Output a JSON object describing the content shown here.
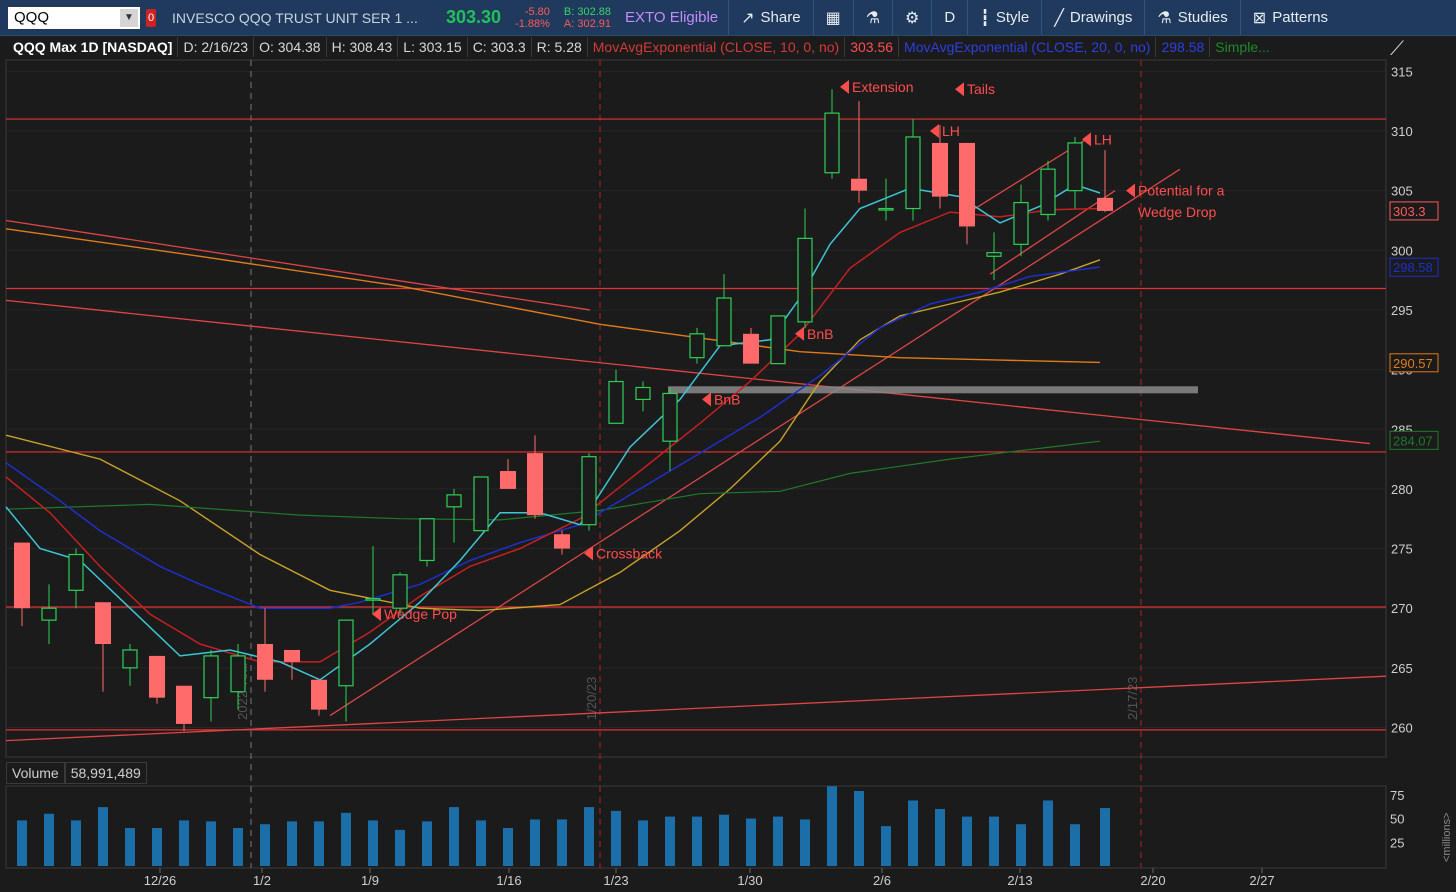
{
  "toolbar": {
    "symbol": "QQQ",
    "alert": "0",
    "description": "INVESCO QQQ TRUST UNIT SER 1 ...",
    "last": "303.30",
    "net_change": "-5.80",
    "pct_change": "-1.88%",
    "bid": "B: 302.88",
    "ask": "A: 302.91",
    "exto": "EXTO Eligible",
    "share": "Share",
    "aggregation": "D",
    "style": "Style",
    "drawings": "Drawings",
    "studies": "Studies",
    "patterns": "Patterns"
  },
  "legend": {
    "title": "QQQ Max 1D [NASDAQ]",
    "date": "D: 2/16/23",
    "open": "O: 304.38",
    "high": "H: 308.43",
    "low": "L: 303.15",
    "close": "C: 303.3",
    "range": "R: 5.28",
    "ema10": "MovAvgExponential (CLOSE, 10, 0, no)",
    "ema10_value": "303.56",
    "ema20": "MovAvgExponential (CLOSE, 20, 0, no)",
    "ema20_value": "298.58",
    "simple": "Simple..."
  },
  "colors": {
    "up": "#2fcf55",
    "down": "#ff6b6b",
    "ema10": "#c71f1f",
    "ema20": "#1d2fcc",
    "ema8": "#3cc6d6",
    "sma_orange": "#e07b1a",
    "sma_gold": "#c9a227",
    "sma_green": "#1e7a2a",
    "annotation": "#ff4d4d",
    "bg": "#1b1b1b",
    "volume": "#1b6ea8"
  },
  "price_axis": {
    "ticks": [
      "315",
      "310",
      "305",
      "300",
      "295",
      "290",
      "285",
      "280",
      "275",
      "270",
      "265",
      "260"
    ],
    "labels": [
      {
        "text": "303.3",
        "color": "#ff5a5a",
        "price": 303.3
      },
      {
        "text": "298.58",
        "color": "#1d2fcc",
        "price": 298.58
      },
      {
        "text": "290.57",
        "color": "#e07b1a",
        "price": 290.57
      },
      {
        "text": "284.07",
        "color": "#1e7a2a",
        "price": 284.07
      }
    ]
  },
  "date_axis": [
    "12/26",
    "1/2",
    "1/9",
    "1/16",
    "1/23",
    "1/30",
    "2/6",
    "2/13",
    "2/20",
    "2/27"
  ],
  "vertical_markers": [
    {
      "text": "2022 Year"
    },
    {
      "text": "1/20/23"
    },
    {
      "text": "2/17/23"
    }
  ],
  "annotations": [
    "Extension",
    "Tails",
    "LH",
    "LH",
    "Potential for a",
    "Wedge Drop",
    "BnB",
    "BnB",
    "Crossback",
    "Wedge Pop"
  ],
  "volume": {
    "label": "Volume",
    "value": "58,991,489",
    "ticks": [
      "75",
      "50",
      "25"
    ],
    "unit": "<millions>"
  },
  "chart_data": {
    "type": "candlestick",
    "title": "QQQ Max 1D [NASDAQ]",
    "ylim": [
      259,
      316
    ],
    "candles": [
      {
        "o": 275.5,
        "h": 275.5,
        "l": 268.5,
        "c": 270.0
      },
      {
        "o": 269.0,
        "h": 272.0,
        "l": 267.0,
        "c": 270.0
      },
      {
        "o": 271.5,
        "h": 275.0,
        "l": 270.0,
        "c": 274.5
      },
      {
        "o": 270.5,
        "h": 270.5,
        "l": 263.0,
        "c": 267.0
      },
      {
        "o": 265.0,
        "h": 267.0,
        "l": 263.5,
        "c": 266.5
      },
      {
        "o": 266.0,
        "h": 266.0,
        "l": 262.0,
        "c": 262.5
      },
      {
        "o": 263.5,
        "h": 263.5,
        "l": 259.7,
        "c": 260.3
      },
      {
        "o": 262.5,
        "h": 266.5,
        "l": 260.5,
        "c": 266.0
      },
      {
        "o": 263.0,
        "h": 267.0,
        "l": 261.5,
        "c": 266.0
      },
      {
        "o": 267.0,
        "h": 270.0,
        "l": 263.0,
        "c": 264.0
      },
      {
        "o": 266.5,
        "h": 266.5,
        "l": 264.0,
        "c": 265.5
      },
      {
        "o": 264.0,
        "h": 264.0,
        "l": 261.0,
        "c": 261.5
      },
      {
        "o": 263.5,
        "h": 269.0,
        "l": 260.5,
        "c": 269.0
      },
      {
        "o": 270.8,
        "h": 275.2,
        "l": 269.5,
        "c": 270.8
      },
      {
        "o": 270.0,
        "h": 273.0,
        "l": 269.5,
        "c": 272.8
      },
      {
        "o": 274.0,
        "h": 277.5,
        "l": 273.5,
        "c": 277.5
      },
      {
        "o": 278.5,
        "h": 280.0,
        "l": 275.5,
        "c": 279.5
      },
      {
        "o": 276.5,
        "h": 281.0,
        "l": 276.5,
        "c": 281.0
      },
      {
        "o": 281.5,
        "h": 282.5,
        "l": 280.0,
        "c": 280.0
      },
      {
        "o": 283.0,
        "h": 284.5,
        "l": 277.5,
        "c": 277.8
      },
      {
        "o": 276.2,
        "h": 276.5,
        "l": 274.5,
        "c": 275.0
      },
      {
        "o": 277.0,
        "h": 283.0,
        "l": 276.5,
        "c": 282.7
      },
      {
        "o": 285.5,
        "h": 290.0,
        "l": 285.5,
        "c": 289.0
      },
      {
        "o": 287.5,
        "h": 289.0,
        "l": 286.5,
        "c": 288.5
      },
      {
        "o": 284.0,
        "h": 288.5,
        "l": 281.5,
        "c": 288.0
      },
      {
        "o": 291.0,
        "h": 293.5,
        "l": 290.5,
        "c": 293.0
      },
      {
        "o": 292.0,
        "h": 298.0,
        "l": 292.0,
        "c": 296.0
      },
      {
        "o": 293.0,
        "h": 293.5,
        "l": 290.5,
        "c": 290.5
      },
      {
        "o": 290.5,
        "h": 294.5,
        "l": 290.5,
        "c": 294.5
      },
      {
        "o": 294.0,
        "h": 303.5,
        "l": 293.5,
        "c": 301.0
      },
      {
        "o": 306.5,
        "h": 313.5,
        "l": 306.0,
        "c": 311.5
      },
      {
        "o": 306.0,
        "h": 312.5,
        "l": 304.0,
        "c": 305.0
      },
      {
        "o": 303.5,
        "h": 306.0,
        "l": 302.5,
        "c": 303.5
      },
      {
        "o": 303.5,
        "h": 311.0,
        "l": 302.5,
        "c": 309.5
      },
      {
        "o": 309.0,
        "h": 310.5,
        "l": 303.5,
        "c": 304.5
      },
      {
        "o": 309.0,
        "h": 309.0,
        "l": 300.5,
        "c": 302.0
      },
      {
        "o": 299.5,
        "h": 301.5,
        "l": 297.5,
        "c": 299.8
      },
      {
        "o": 300.5,
        "h": 305.5,
        "l": 299.5,
        "c": 304.0
      },
      {
        "o": 303.0,
        "h": 307.5,
        "l": 302.5,
        "c": 306.8
      },
      {
        "o": 305.0,
        "h": 309.5,
        "l": 303.5,
        "c": 309.0
      },
      {
        "o": 304.4,
        "h": 308.4,
        "l": 303.2,
        "c": 303.3
      }
    ],
    "volume_millions": [
      48,
      55,
      48,
      62,
      40,
      40,
      48,
      47,
      40,
      44,
      47,
      47,
      56,
      48,
      38,
      47,
      62,
      48,
      40,
      49,
      49,
      62,
      58,
      48,
      52,
      52,
      54,
      50,
      52,
      49,
      84,
      79,
      42,
      69,
      60,
      52,
      52,
      44,
      69,
      44,
      61
    ]
  }
}
